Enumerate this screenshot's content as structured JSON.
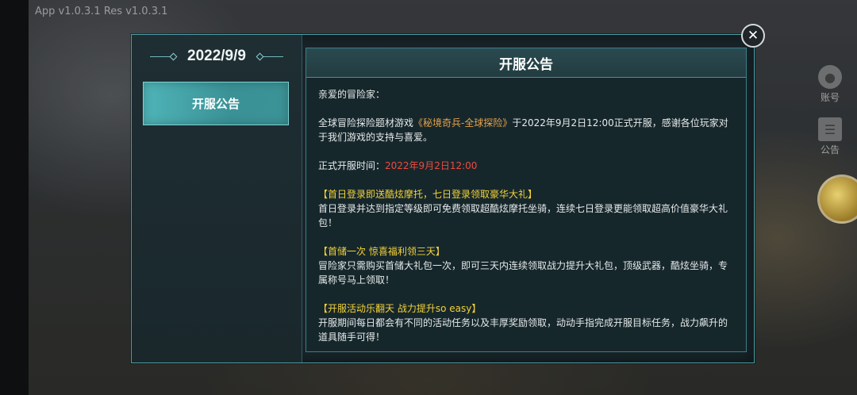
{
  "version_text": "App v1.0.3.1 Res v1.0.3.1",
  "side_buttons": {
    "account_label": "账号",
    "notice_label": "公告"
  },
  "dialog": {
    "date": "2022/9/9",
    "tabs": [
      {
        "label": "开服公告",
        "selected": true
      }
    ],
    "title": "开服公告",
    "greeting": "亲爱的冒险家：",
    "intro_prefix": "全球冒险探险题材游戏",
    "game_name": "《秘境奇兵-全球探险》",
    "intro_suffix": "于2022年9月2日12:00正式开服，感谢各位玩家对于我们游戏的支持与喜爱。",
    "launch_time_label": "正式开服时间：",
    "launch_time_value": "2022年9月2日12:00",
    "sections": [
      {
        "heading": "【首日登录即送酷炫摩托，七日登录领取豪华大礼】",
        "body": "首日登录并达到指定等级即可免费领取超酷炫摩托坐骑，连续七日登录更能领取超高价值豪华大礼包！"
      },
      {
        "heading": "【首储一次 惊喜福利领三天】",
        "body": "冒险家只需购买首储大礼包一次，即可三天内连续领取战力提升大礼包，顶级武器，酷炫坐骑，专属称号马上领取！"
      },
      {
        "heading": "【开服活动乐翻天 战力提升so easy】",
        "body": "开服期间每日都会有不同的活动任务以及丰厚奖励领取，动动手指完成开服目标任务，战力飙升的道具随手可得！"
      }
    ]
  },
  "colors": {
    "accent_teal": "#4fb4b8",
    "game_name_orange": "#e5a24a",
    "time_red": "#ef4a3e",
    "heading_yellow": "#f2d23a"
  }
}
